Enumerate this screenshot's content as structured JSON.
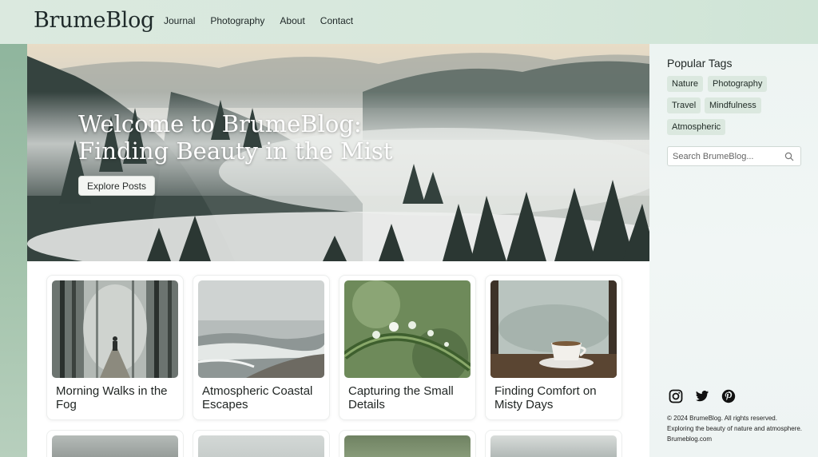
{
  "header": {
    "logo": "BrumeBlog",
    "nav": [
      "Journal",
      "Photography",
      "About",
      "Contact"
    ]
  },
  "hero": {
    "title": "Welcome to BrumeBlog: Finding Beauty in the Mist",
    "button_label": "Explore Posts"
  },
  "posts": [
    {
      "title": "Morning Walks in the Fog"
    },
    {
      "title": "Atmospheric Coastal Escapes"
    },
    {
      "title": "Capturing the Small Details"
    },
    {
      "title": "Finding Comfort on Misty Days"
    }
  ],
  "sidebar": {
    "tags_title": "Popular Tags",
    "tags": [
      "Nature",
      "Photography",
      "Travel",
      "Mindfulness",
      "Atmospheric"
    ],
    "search_placeholder": "Search BrumeBlog..."
  },
  "social": {
    "icons": [
      "instagram-icon",
      "twitter-icon",
      "pinterest-icon"
    ]
  },
  "footer": {
    "copyright": "© 2024 BrumeBlog. All rights reserved.",
    "tagline": "Exploring the beauty of nature and atmosphere.",
    "site": "Brumeblog.com"
  },
  "colors": {
    "accent_green": "#8fb59d",
    "tag_bg": "#dbe8df",
    "header_bg": "#d6e8dc"
  }
}
